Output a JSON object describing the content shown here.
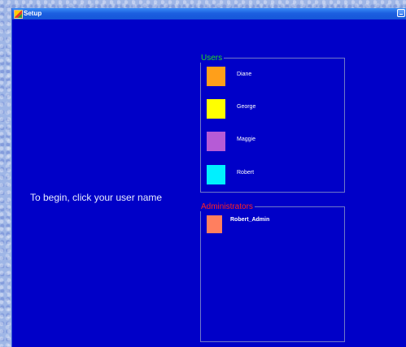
{
  "window": {
    "title": "Setup",
    "minimize_icon": "minimize-icon",
    "app_icon": "setup-app-icon"
  },
  "instruction": "To begin, click your user name",
  "users_group": {
    "label": "Users",
    "label_color": "#22dd22",
    "items": [
      {
        "name": "Diane",
        "color": "#ff9f1a"
      },
      {
        "name": "George",
        "color": "#ffff00"
      },
      {
        "name": "Maggie",
        "color": "#b65bd6"
      },
      {
        "name": "Robert",
        "color": "#00f0ff"
      }
    ]
  },
  "admins_group": {
    "label": "Administrators",
    "label_color": "#ff2222",
    "items": [
      {
        "name": "Robert_Admin",
        "color": "#ff7f5f"
      }
    ]
  }
}
